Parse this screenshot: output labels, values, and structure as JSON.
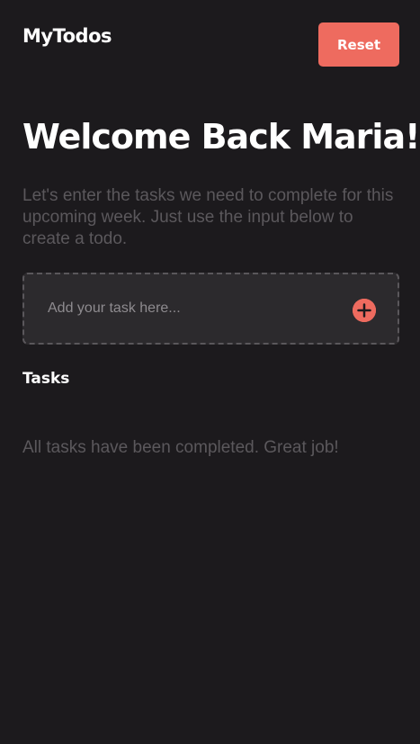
{
  "header": {
    "app_title": "MyTodos",
    "reset_label": "Reset"
  },
  "hero": {
    "title": "Welcome Back Maria!",
    "subtitle": "Let's enter the tasks we need to complete for this upcoming week. Just use the input below to create a todo."
  },
  "task_input": {
    "value": "",
    "placeholder": "Add your task here...",
    "add_icon": "plus-circle-icon"
  },
  "tasks": {
    "heading": "Tasks",
    "items": [],
    "empty_message": "All tasks have been completed. Great job!"
  },
  "colors": {
    "background": "#1c1a1d",
    "accent": "#ee6b5f",
    "muted_text": "#5b585c",
    "input_background": "#2c2a2d",
    "input_border": "#5a575b"
  }
}
